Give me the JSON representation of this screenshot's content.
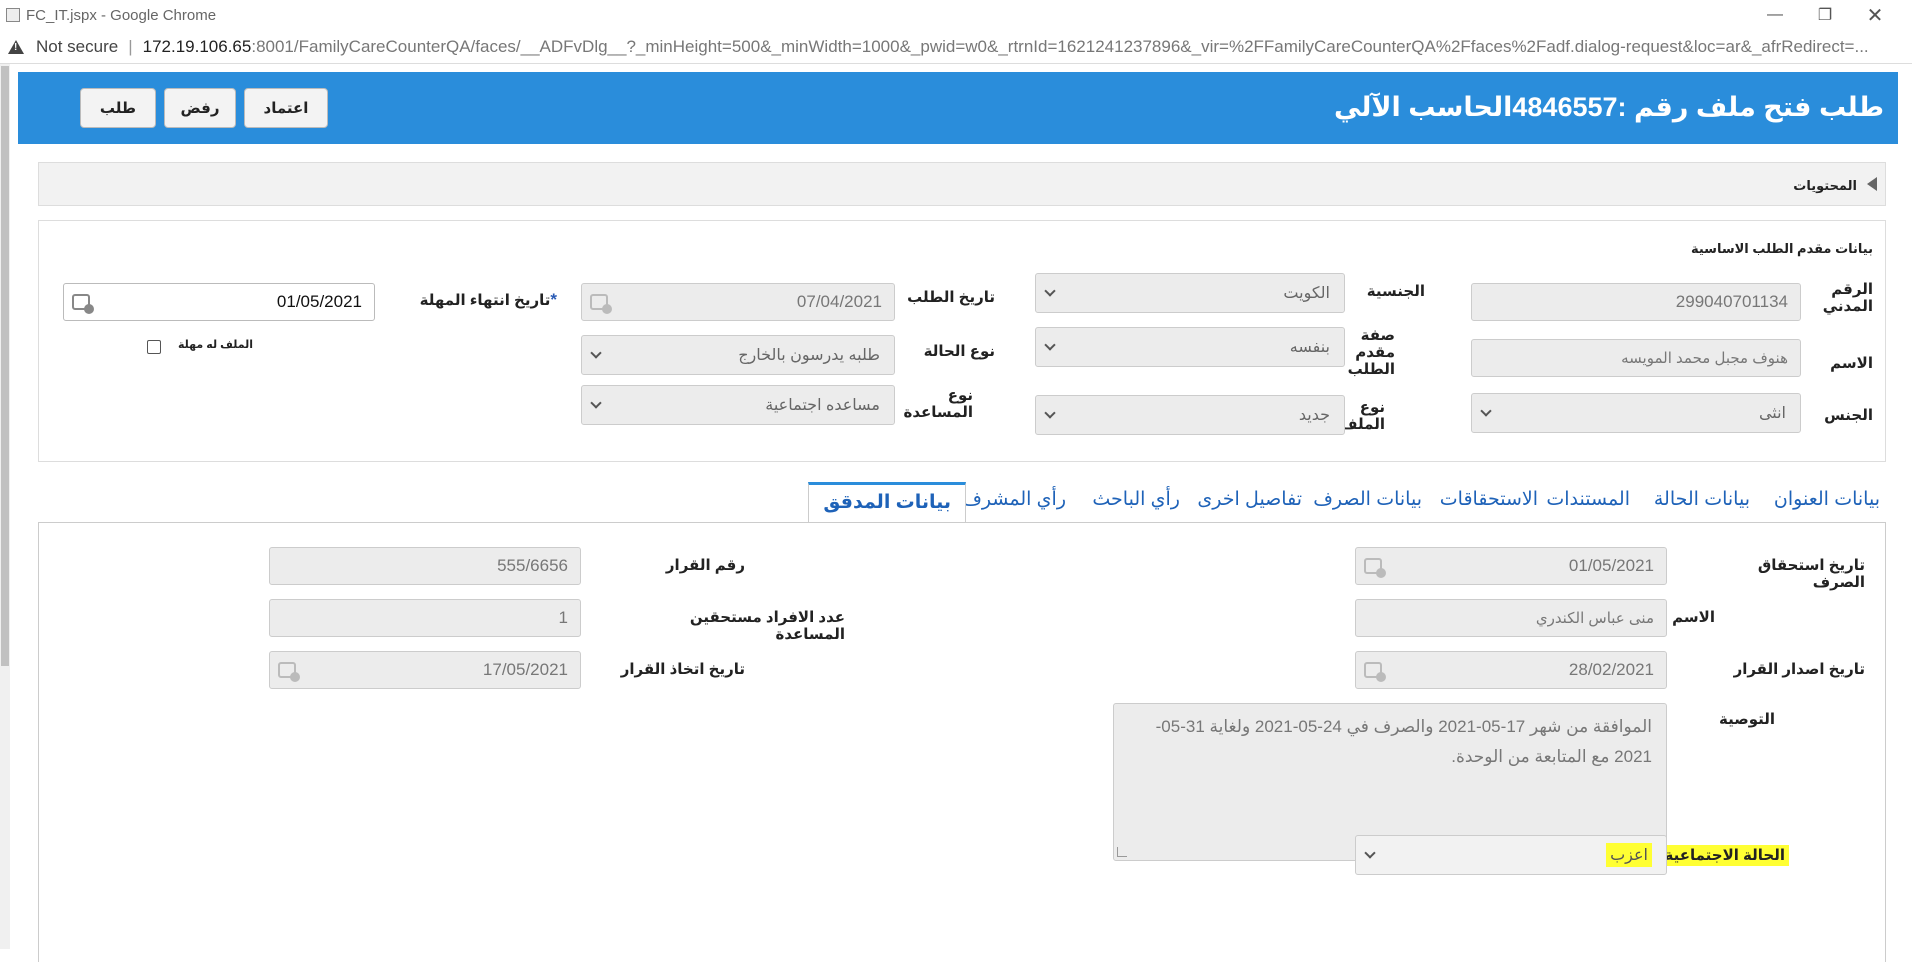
{
  "browser": {
    "window_title": "FC_IT.jspx - Google Chrome",
    "not_secure": "Not secure",
    "url_host": "172.19.106.65",
    "url_rest": ":8001/FamilyCareCounterQA/faces/__ADFvDlg__?_minHeight=500&_minWidth=1000&_pwid=w0&_rtrnId=1621241237896&_vir=%2FFamilyCareCounterQA%2Ffaces%2Fadf.dialog-request&loc=ar&_afrRedirect=..."
  },
  "header": {
    "title": "طلب فتح ملف رقم :4846557الحاسب الآلي",
    "approve_label": "اعتماد",
    "reject_label": "رفض",
    "request_label": "طلب",
    "color": "#2a8ddb"
  },
  "contents": {
    "label": "المحتويات"
  },
  "applicant": {
    "section_title": "بيانات مقدم الطلب الاساسية",
    "civil_id_label": "الرقم المدني",
    "civil_id": "299040701134",
    "name_label": "الاسم",
    "name": "هنوف مجبل محمد المويسه",
    "gender_label": "الجنس",
    "gender": "انثى",
    "nationality_label": "الجنسية",
    "nationality": "الكويت",
    "applicant_capacity_label": "صفة مقدم الطلب",
    "applicant_capacity": "بنفسه",
    "file_type_label": "نوع الملف",
    "file_type": "جديد",
    "request_date_label": "تاريخ الطلب",
    "request_date": "07/04/2021",
    "case_type_label": "نوع الحالة",
    "case_type": "طلبه يدرسون بالخارج",
    "aid_type_label": "نوع المساعدة",
    "aid_type": "مساعده اجتماعية",
    "deadline_label": "تاريخ انتهاء المهلة",
    "required_mark": "*",
    "deadline": "01/05/2021",
    "has_grace_label": "الملف له مهلة"
  },
  "tabs": [
    {
      "label": "بيانات العنوان"
    },
    {
      "label": "بيانات الحالة"
    },
    {
      "label": "المستندات"
    },
    {
      "label": "الاستحقاقات"
    },
    {
      "label": "بيانات الصرف"
    },
    {
      "label": "تفاصيل اخرى"
    },
    {
      "label": "رأي الباحث"
    },
    {
      "label": "رأي المشرف"
    },
    {
      "label": "بيانات المدقق"
    }
  ],
  "auditor": {
    "entitlement_date_label": "تاريخ استحقاق الصرف",
    "entitlement_date": "01/05/2021",
    "name_label": "الاسم",
    "name": "منى عباس الكندري",
    "issue_date_label": "تاريخ اصدار القرار",
    "issue_date": "28/02/2021",
    "decision_no_label": "رقم القرار",
    "decision_no": "555/6656",
    "eligible_count_label": "عدد الافراد مستحقين المساعدة",
    "eligible_count": "1",
    "decision_date_label": "تاريخ اتخاذ القرار",
    "decision_date": "17/05/2021",
    "recommendation_label": "التوصية",
    "recommendation": "الموافقة  من شهر 17-05-2021 والصرف في 24-05-2021 ولغاية 31-05-2021  مع المتابعة من الوحدة.",
    "social_status_label": "الحالة الاجتماعية",
    "social_status": "اعزب"
  }
}
